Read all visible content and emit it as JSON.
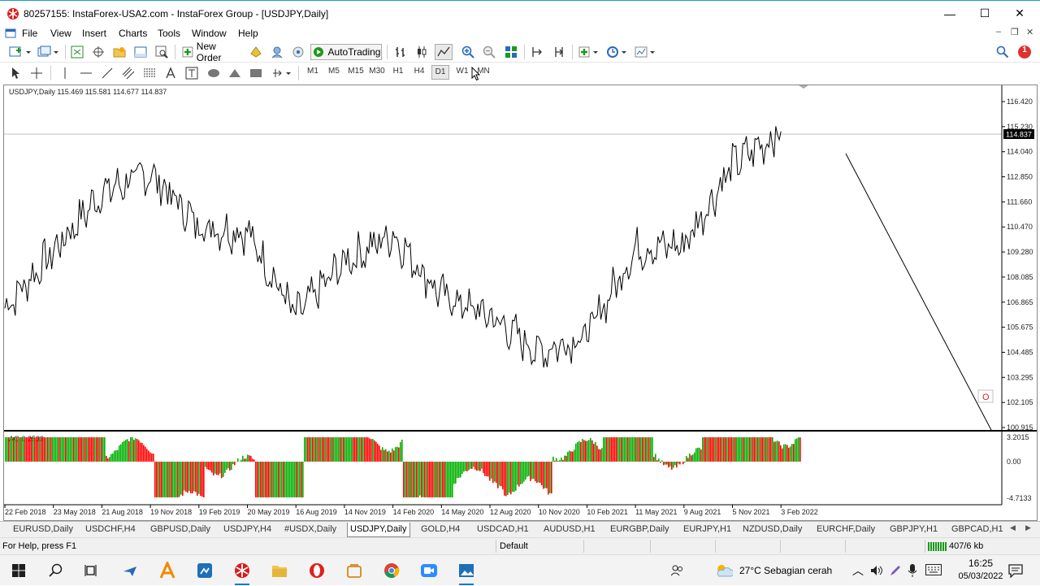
{
  "window": {
    "title": "80257155: InstaForex-USA2.com - InstaForex Group - [USDJPY,Daily]",
    "minimize": "—",
    "maximize": "☐",
    "close": "✕"
  },
  "menu": {
    "items": [
      "File",
      "View",
      "Insert",
      "Charts",
      "Tools",
      "Window",
      "Help"
    ],
    "mdi_min": "–",
    "mdi_restore": "❐",
    "mdi_close": "✕"
  },
  "toolbar": {
    "new_order": "New Order",
    "auto_trading": "AutoTrading",
    "notification_count": "1"
  },
  "timeframes": [
    "M1",
    "M5",
    "M15",
    "M30",
    "H1",
    "H4",
    "D1",
    "W1",
    "MN"
  ],
  "chart": {
    "header": "USDJPY,Daily  115.469 115.581 114.677 114.837",
    "indicator_label": "AO 0.2533",
    "current_price": "114.837",
    "price_ticks": [
      "116.420",
      "115.230",
      "114.040",
      "112.850",
      "111.660",
      "110.470",
      "109.280",
      "108.085",
      "106.865",
      "105.675",
      "104.485",
      "103.295",
      "102.105",
      "100.915"
    ],
    "ao_ticks": [
      "3.2015",
      "0.00",
      "-4.7133"
    ],
    "date_ticks": [
      "22 Feb 2018",
      "23 May 2018",
      "21 Aug 2018",
      "19 Nov 2018",
      "19 Feb 2019",
      "20 May 2019",
      "16 Aug 2019",
      "14 Nov 2019",
      "14 Feb 2020",
      "14 May 2020",
      "12 Aug 2020",
      "10 Nov 2020",
      "10 Feb 2021",
      "11 May 2021",
      "9 Aug 2021",
      "5 Nov 2021",
      "3 Feb 2022"
    ],
    "price_marker": "O",
    "colors": {
      "ao_up": "#00b000",
      "ao_down": "#ff0000",
      "price_line": "#000000",
      "current_price_bg": "#000000"
    }
  },
  "chart_data": {
    "type": "line",
    "title": "USDJPY,Daily",
    "ylim": [
      100.915,
      116.42
    ],
    "x": [
      "22 Feb 2018",
      "23 May 2018",
      "21 Aug 2018",
      "19 Nov 2018",
      "19 Feb 2019",
      "20 May 2019",
      "16 Aug 2019",
      "14 Nov 2019",
      "14 Feb 2020",
      "14 May 2020",
      "12 Aug 2020",
      "10 Nov 2020",
      "10 Feb 2021",
      "11 May 2021",
      "9 Aug 2021",
      "5 Nov 2021",
      "3 Feb 2022"
    ],
    "series": [
      {
        "values": [
          106.6,
          109.3,
          112.1,
          113.0,
          110.5,
          110.2,
          106.2,
          108.8,
          110.1,
          107.2,
          106.2,
          104.5,
          105.3,
          109.4,
          109.6,
          113.4,
          115.0
        ]
      }
    ]
  },
  "tabs": [
    "EURUSD,Daily",
    "USDCHF,H4",
    "GBPUSD,Daily",
    "USDJPY,H4",
    "#USDX,Daily",
    "USDJPY,Daily",
    "GOLD,H4",
    "USDCAD,H1",
    "AUDUSD,H1",
    "EURGBP,Daily",
    "EURJPY,H1",
    "NZDUSD,Daily",
    "EURCHF,Daily",
    "GBPJPY,H1",
    "GBPCAD,H1"
  ],
  "active_tab": "USDJPY,Daily",
  "status": {
    "help": "For Help, press F1",
    "profile": "Default",
    "traffic": "407/6 kb"
  },
  "taskbar": {
    "weather": "27°C  Sebagian cerah",
    "time": "16:25",
    "date": "05/03/2022"
  }
}
